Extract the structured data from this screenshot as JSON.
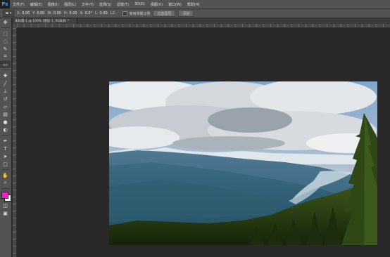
{
  "app": {
    "logo": "Ps",
    "menu": [
      "文件(F)",
      "编辑(E)",
      "图像(I)",
      "图层(L)",
      "文字(Y)",
      "选择(S)",
      "滤镜(T)",
      "3D(D)",
      "视图(V)",
      "窗口(W)",
      "帮助(H)"
    ]
  },
  "options": {
    "tool_label": "▬ ▾",
    "x_label": "X:",
    "x_value": "0.00",
    "y_label": "Y:",
    "y_value": "0.00",
    "w_label": "W:",
    "w_value": "0.00",
    "h_label": "H:",
    "h_value": "0.00",
    "a_label": "A:",
    "a_value": "0.0°",
    "l_label": "L:",
    "l_value": "0.00",
    "l2_label": "L2:",
    "proportional_label": "使用测量比例",
    "straighten_button": "拉直图层",
    "clear_button": "清除"
  },
  "document": {
    "tab_label": "未标题-1 @ 100% (图层 1, RGB/8) *"
  },
  "colors": {
    "foreground": "#ff18c8",
    "background": "#ffffff",
    "accent": "#31a8ff"
  },
  "tools": [
    "move-icon",
    "marquee-icon",
    "lasso-icon",
    "quick-select-icon",
    "crop-icon",
    "ruler-icon",
    "healing-icon",
    "brush-icon",
    "clone-stamp-icon",
    "history-brush-icon",
    "eraser-icon",
    "gradient-icon",
    "blur-icon",
    "dodge-icon",
    "pen-icon",
    "type-icon",
    "path-select-icon",
    "shape-icon",
    "hand-icon",
    "zoom-icon",
    "quick-mask-icon",
    "screen-mode-icon"
  ]
}
